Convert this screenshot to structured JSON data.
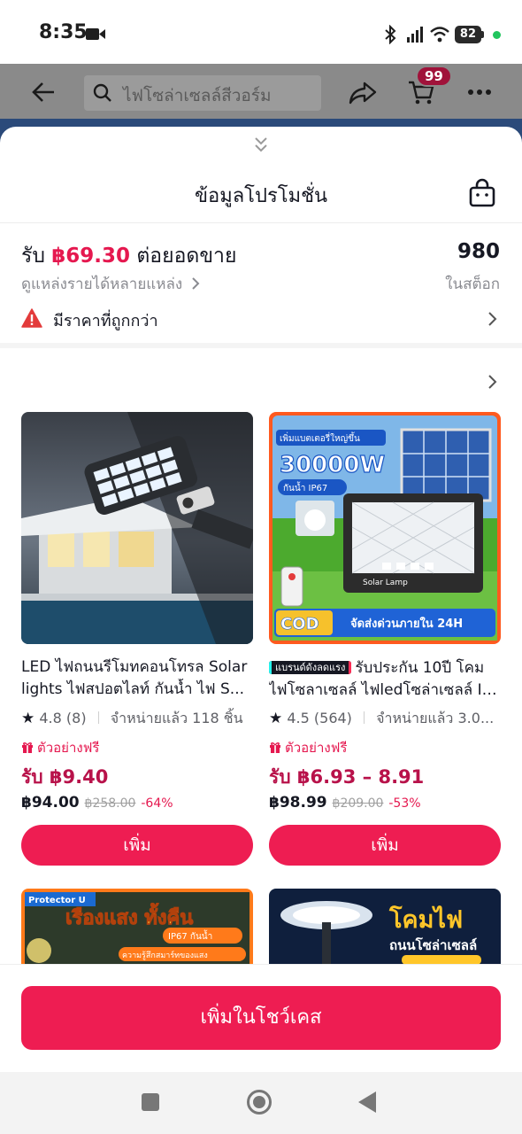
{
  "status_bar": {
    "time": "8:35",
    "battery": "82"
  },
  "header": {
    "search_placeholder": "ไฟโซล่าเซลล์สีวอร์ม",
    "cart_badge": "99"
  },
  "sheet": {
    "title": "ข้อมูลโปรโมชั่น",
    "earn_prefix": "รับ",
    "earn_amount": "฿69.30",
    "earn_suffix": "ต่อยอดขาย",
    "sources_link": "ดูแหล่งรายได้หลายแหล่ง",
    "stock_count": "980",
    "stock_label": "ในสต็อก",
    "warning_text": "มีราคาที่ถูกกว่า"
  },
  "products": [
    {
      "title_line1": "LED ไฟถนนรีโมทคอนโทรล Solar",
      "title_line2": "lights ไฟสปอตไลท์ กันน้ำ ไฟ S...",
      "rating": "4.8",
      "reviews": "(8)",
      "sold": "จำหน่ายแล้ว 118 ชิ้น",
      "free_sample": "ตัวอย่างฟรี",
      "earn": "รับ ฿9.40",
      "price": "฿94.00",
      "original_price": "฿258.00",
      "discount": "-64%",
      "add_label": "เพิ่ม"
    },
    {
      "brand_tag": "แบรนด์ดังลดแรง",
      "title_line1": "รับประกัน 10ปี โคม",
      "title_line2": "ไฟโซลาเซลล์ ไฟledโซล่าเซลล์ IP...",
      "rating": "4.5",
      "reviews": "(564)",
      "sold": "จำหน่ายแล้ว 3.0...",
      "free_sample": "ตัวอย่างฟรี",
      "earn": "รับ ฿6.93 – 8.91",
      "price": "฿98.99",
      "original_price": "฿209.00",
      "discount": "-53%",
      "add_label": "เพิ่ม",
      "img_banner": "เพิ่มแบตเตอรี่ใหญ่ขึ้น",
      "img_watt": "30000W",
      "img_ip": "กันน้ำ IP67",
      "img_lamp": "Solar Lamp",
      "img_cod": "COD",
      "img_ship": "จัดส่งด่วนภายใน 24H"
    }
  ],
  "thumbnails": [
    {
      "brand": "Protector U",
      "headline": "เรืองแสง ทั้งคืน",
      "ip": "IP67 กันน้ำ",
      "sub": "ความรู้สึกสมาร์ทของแสง"
    },
    {
      "headline1": "โคมไฟ",
      "headline2": "ถนนโซล่าเซลล์"
    }
  ],
  "footer": {
    "showcase_button": "เพิ่มในโชว์เคส"
  },
  "colors": {
    "accent": "#ee1d52",
    "earn": "#e5184f"
  }
}
